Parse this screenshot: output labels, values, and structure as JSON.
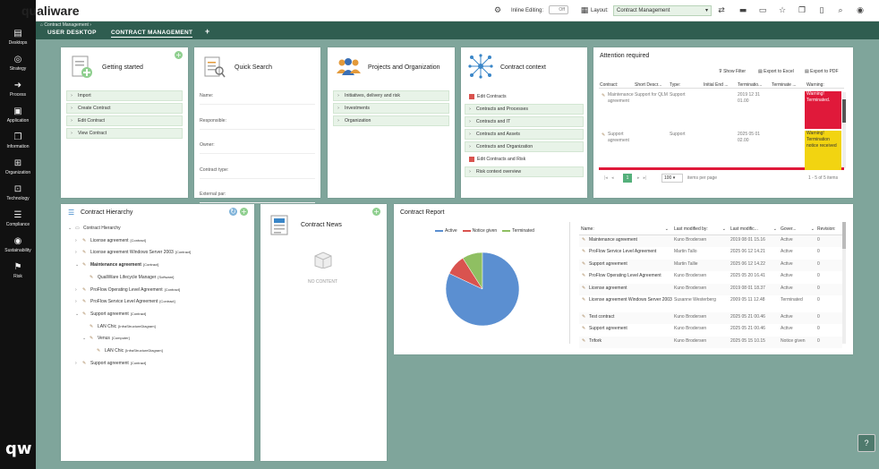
{
  "app": {
    "brand": "qualiware"
  },
  "nav": [
    {
      "label": "Desktops",
      "icon": "document-icon",
      "glyph": "▤"
    },
    {
      "label": "Strategy",
      "icon": "target-icon",
      "glyph": "◎"
    },
    {
      "label": "Process",
      "icon": "arrow-icon",
      "glyph": "➜"
    },
    {
      "label": "Application",
      "icon": "window-icon",
      "glyph": "▣"
    },
    {
      "label": "Information",
      "icon": "files-icon",
      "glyph": "❐"
    },
    {
      "label": "Organization",
      "icon": "org-icon",
      "glyph": "⊞"
    },
    {
      "label": "Technology",
      "icon": "chip-icon",
      "glyph": "⊡"
    },
    {
      "label": "Compliance",
      "icon": "checklist-icon",
      "glyph": "☰"
    },
    {
      "label": "Sustainability",
      "icon": "leaf-icon",
      "glyph": "◉"
    },
    {
      "label": "Risk",
      "icon": "flag-icon",
      "glyph": "⚑"
    }
  ],
  "topbar": {
    "inline_label": "Inline Editing:",
    "inline_value": "Off",
    "layout_label": "Layout:",
    "layout_value": "Contract Management"
  },
  "tabs": {
    "breadcrumb": "Contract Management",
    "user_desktop": "USER DESKTOP",
    "contract_management": "CONTRACT MANAGEMENT",
    "add": "+"
  },
  "getting_started": {
    "title": "Getting started",
    "items": [
      "Import",
      "Create Contract",
      "Edit Contract",
      "View Contract"
    ]
  },
  "quick_search": {
    "title": "Quick Search",
    "fields": [
      "Name:",
      "Responsible:",
      "Owner:",
      "Contract type:",
      "External par:"
    ]
  },
  "projects": {
    "title": "Projects and Organization",
    "items": [
      "Initiatives, delivery and risk",
      "Investments",
      "Organization"
    ]
  },
  "contract_context": {
    "title": "Contract context",
    "items": [
      {
        "label": "Edit Contracts",
        "kind": "calendar"
      },
      {
        "label": "Contracts and Processes",
        "kind": "chevron"
      },
      {
        "label": "Contracts and IT",
        "kind": "chevron"
      },
      {
        "label": "Contracts and Assets",
        "kind": "chevron"
      },
      {
        "label": "Contracts and Organization",
        "kind": "chevron"
      },
      {
        "label": "Edit Contracts and Risk",
        "kind": "calendar"
      },
      {
        "label": "Risk context overview",
        "kind": "chevron"
      }
    ]
  },
  "attention": {
    "title": "Attention required",
    "show_filter": "Show Filter",
    "export_excel": "Export to Excel",
    "export_pdf": "Export to PDF",
    "headers": [
      "Contract:",
      "Short Descr...",
      "Type:",
      "Initial End ...",
      "Terminatio...",
      "Terminate ...",
      "Warning:"
    ],
    "rows": [
      {
        "contract": "Maintenance agreement",
        "short": "Support for QLM",
        "type": "Support",
        "initial": "",
        "termination": "2019 12 31 01.00",
        "terminate": "",
        "warning": "Warning! Terminated.",
        "color": "#e0193a"
      },
      {
        "contract": "Support agreement",
        "short": "",
        "type": "Support",
        "initial": "",
        "termination": "2025 05 01 02.00",
        "terminate": "",
        "warning": "Warning! Termination notice received",
        "color": "#f2d411"
      }
    ],
    "page": "1",
    "page_size": "100",
    "per_page": "items per page",
    "range": "1 - 5 of 5 items"
  },
  "hierarchy": {
    "title": "Contract Hierarchy",
    "nodes": [
      {
        "label": "Contract Hierarchy",
        "tag": "",
        "level": 0,
        "exp": "v"
      },
      {
        "label": "License agreement",
        "tag": "[Contract]",
        "level": 1,
        "exp": ">"
      },
      {
        "label": "License agreement Windows Server 2003",
        "tag": "[Contract]",
        "level": 1,
        "exp": ">"
      },
      {
        "label": "Maintenance agreement",
        "tag": "[Contract]",
        "level": 1,
        "exp": "v"
      },
      {
        "label": "QualiWare Lifecycle Manager",
        "tag": "[Software]",
        "level": 2,
        "exp": ""
      },
      {
        "label": "ProFlow Operating Level Agreement",
        "tag": "[Contract]",
        "level": 1,
        "exp": ">"
      },
      {
        "label": "ProFlow Service Level Agreement",
        "tag": "[Contract]",
        "level": 1,
        "exp": ">"
      },
      {
        "label": "Support agreement",
        "tag": "[Contract]",
        "level": 1,
        "exp": "v"
      },
      {
        "label": "LAN Chic",
        "tag": "[InfraStructureDiagram]",
        "level": 2,
        "exp": ""
      },
      {
        "label": "Venus",
        "tag": "[Computer]",
        "level": 2,
        "exp": "v"
      },
      {
        "label": "LAN Chic",
        "tag": "[InfraStructureDiagram]",
        "level": 3,
        "exp": ""
      },
      {
        "label": "Support agreement",
        "tag": "[Contract]",
        "level": 1,
        "exp": ">"
      }
    ]
  },
  "news": {
    "title": "Contract News",
    "empty": "NO CONTENT"
  },
  "report": {
    "title": "Contract Report",
    "headers": [
      "Name:",
      "Last modified by:",
      "Last modific...",
      "Gover...",
      "Revision:"
    ],
    "rows": [
      [
        "Maintenance agreement",
        "Kuno Brodersen",
        "2019 08 01 15.16",
        "Active",
        "0"
      ],
      [
        "ProFlow Service Level Agreement",
        "Martin Tallo",
        "2025 06 12 14.21",
        "Active",
        "0"
      ],
      [
        "Support agreement",
        "Martin Tallie",
        "2025 06 12 14.22",
        "Active",
        "0"
      ],
      [
        "ProFlow Operating Level Agreement",
        "Kuno Brodersen",
        "2025 05 20 16.41",
        "Active",
        "0"
      ],
      [
        "License agreement",
        "Kuno Brodersen",
        "2019 08 01 18.37",
        "Active",
        "0"
      ],
      [
        "License agreement Windows Server 2003",
        "Susanne Westerberg",
        "2009 05 11 12.48",
        "Terminated",
        "0"
      ],
      [
        "Test contract",
        "Kuno Brodersen",
        "2025 05 21 00.46",
        "Active",
        "0"
      ],
      [
        "Support agreement",
        "Kuno Brodersen",
        "2025 05 21 00.46",
        "Active",
        "0"
      ],
      [
        "Trifork",
        "Kuno Brodersen",
        "2025 05 15 10.15",
        "Notice given",
        "0"
      ]
    ]
  },
  "chart_data": {
    "type": "pie",
    "legend": [
      "Active",
      "Notice given",
      "Terminated"
    ],
    "colors": [
      "#5b8fd1",
      "#d9534f",
      "#8fbf62"
    ],
    "values": [
      82,
      9,
      9
    ]
  },
  "help": "?"
}
